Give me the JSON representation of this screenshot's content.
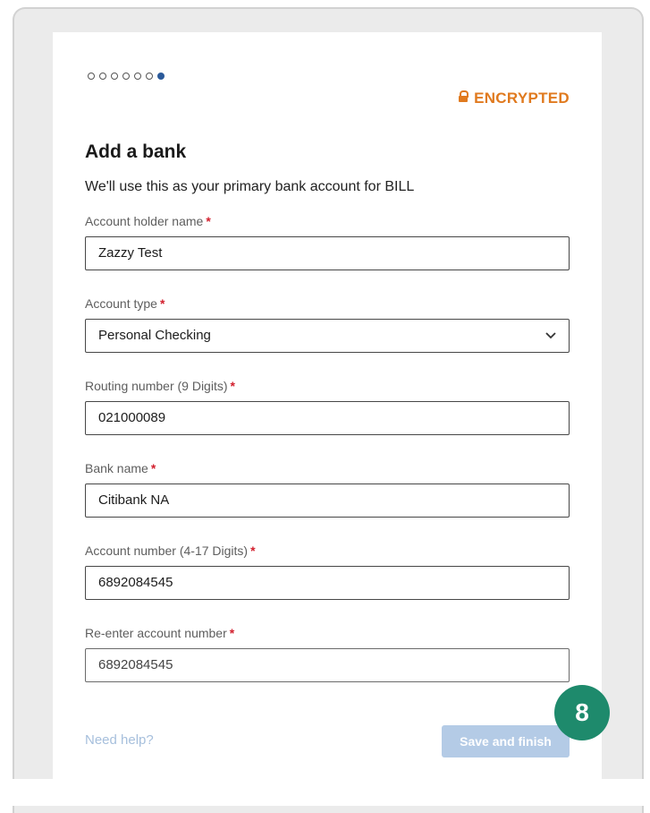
{
  "progress": {
    "total_steps": 7,
    "current_step": 7
  },
  "security": {
    "label": "ENCRYPTED"
  },
  "form": {
    "title": "Add a bank",
    "subtitle": "We'll use this as your primary bank account for BILL",
    "required_mark": "*",
    "fields": [
      {
        "label": "Account holder name",
        "value": "Zazzy Test"
      },
      {
        "label": "Account type",
        "value": "Personal Checking"
      },
      {
        "label": "Routing number (9 Digits)",
        "value": "021000089"
      },
      {
        "label": "Bank name",
        "value": "Citibank NA"
      },
      {
        "label": "Account number (4-17 Digits)",
        "value": "6892084545"
      },
      {
        "label": "Re-enter account number",
        "value": "6892084545"
      }
    ]
  },
  "footer": {
    "help_link": "Need help?",
    "save_button": "Save and finish"
  },
  "step_badge": "8",
  "colors": {
    "accent_orange": "#e07a1f",
    "primary_blue": "#2b5a9a",
    "badge_green": "#1e8a6c",
    "required_red": "#d21f2d"
  }
}
